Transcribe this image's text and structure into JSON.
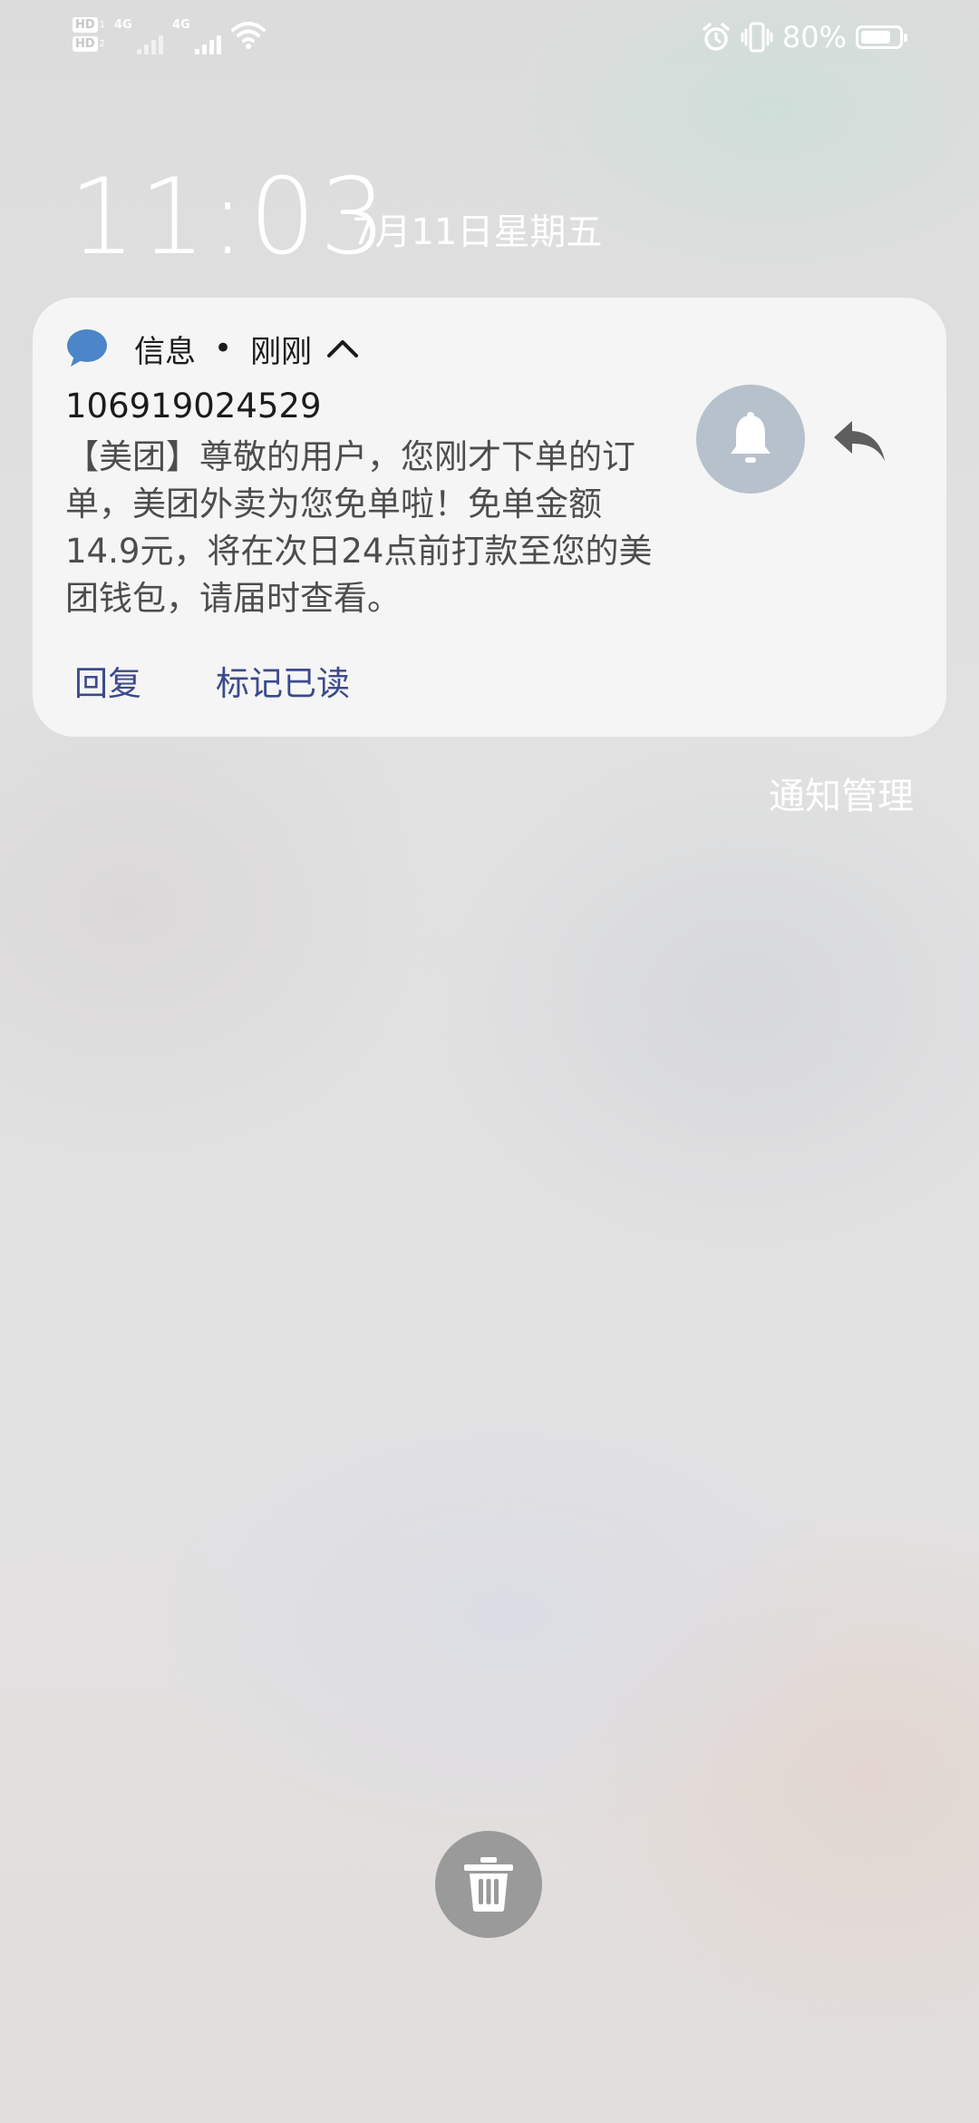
{
  "status_bar": {
    "hd_sims": [
      {
        "label": "HD",
        "sub": "1"
      },
      {
        "label": "HD",
        "sub": "2"
      }
    ],
    "network_1": "4G",
    "network_2": "4G",
    "battery_percent": "80%",
    "battery_level": 0.8,
    "icons": [
      "alarm-icon",
      "vibrate-icon",
      "wifi-icon",
      "battery-icon"
    ]
  },
  "clock": {
    "time": "11:03",
    "date": "7月11日星期五"
  },
  "notification": {
    "app_name": "信息",
    "separator": "•",
    "time": "刚刚",
    "sender": "106919024529",
    "body": "【美团】尊敬的用户，您刚才下单的订单，美团外卖为您免单啦！免单金额14.9元，将在次日24点前打款至您的美团钱包，请届时查看。",
    "actions": {
      "reply": "回复",
      "mark_read": "标记已读"
    },
    "colors": {
      "accent": "#3b4a8c",
      "app_icon": "#4a86c8"
    }
  },
  "notification_manage": "通知管理"
}
